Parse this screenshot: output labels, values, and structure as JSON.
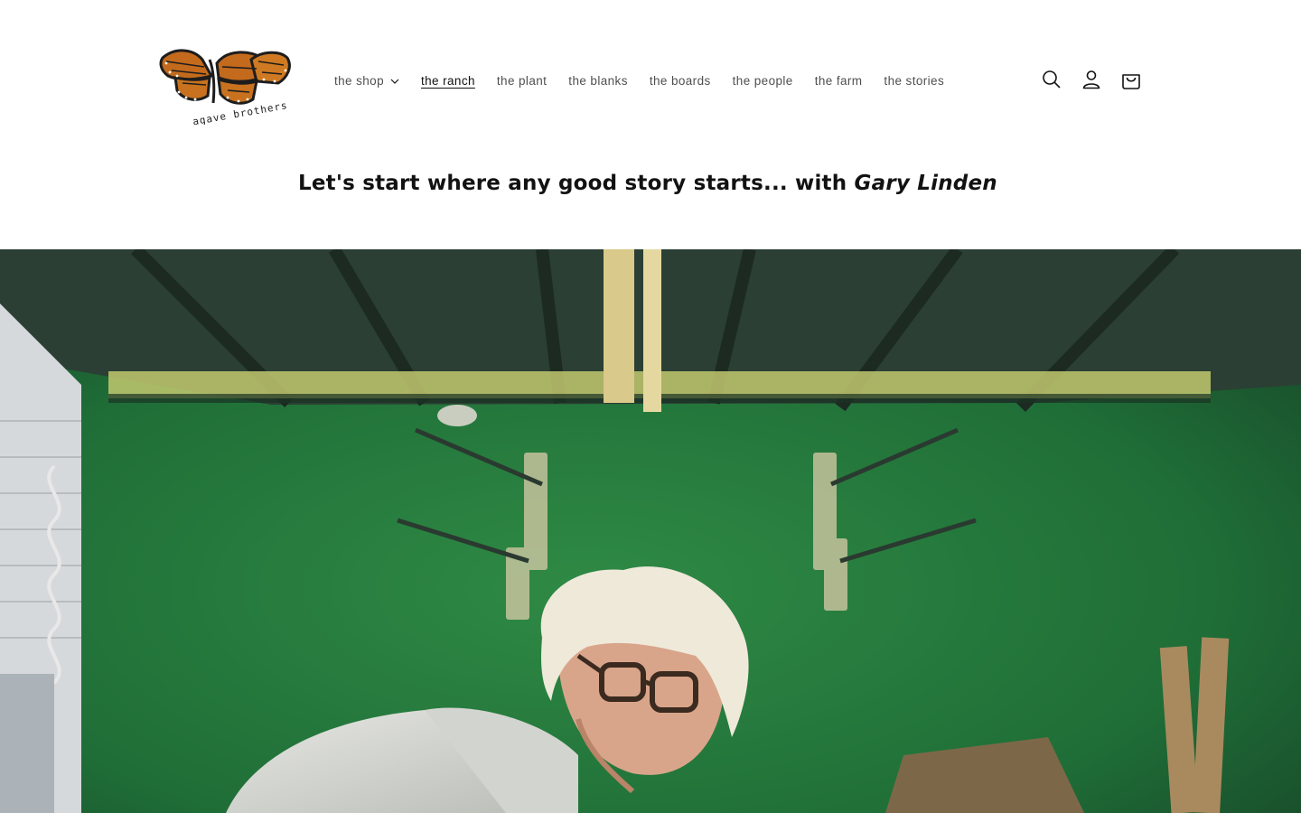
{
  "brand": {
    "logo_text": "agave brothers"
  },
  "nav": {
    "items": [
      {
        "label": "the shop",
        "has_dropdown": true
      },
      {
        "label": "the ranch",
        "active": true
      },
      {
        "label": "the plant"
      },
      {
        "label": "the blanks"
      },
      {
        "label": "the boards"
      },
      {
        "label": "the people"
      },
      {
        "label": "the farm"
      },
      {
        "label": "the stories"
      }
    ]
  },
  "header_icons": [
    "search-icon",
    "account-icon",
    "cart-icon"
  ],
  "intro": {
    "text": "Let's start where any good story starts... with ",
    "emphasis": "Gary Linden"
  },
  "colors": {
    "text": "#121212",
    "hero_green": "#1b6b34",
    "background": "#ffffff"
  }
}
